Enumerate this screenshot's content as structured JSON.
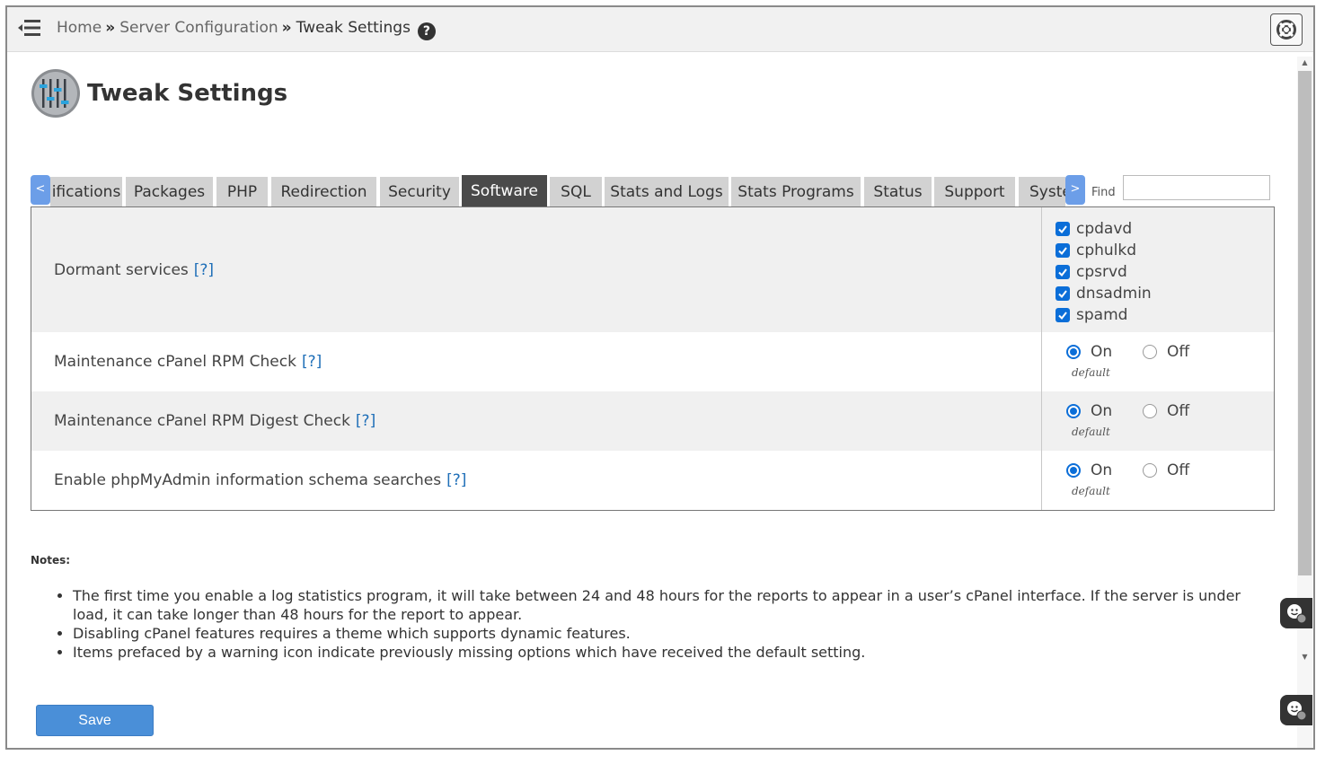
{
  "breadcrumb": {
    "home": "Home",
    "separator": "»",
    "section": "Server Configuration",
    "current": "Tweak Settings",
    "help_glyph": "?"
  },
  "page": {
    "title": "Tweak Settings"
  },
  "tabs": {
    "scroll_left": "<",
    "scroll_right": ">",
    "items": [
      "ifications",
      "Packages",
      "PHP",
      "Redirection",
      "Security",
      "Software",
      "SQL",
      "Stats and Logs",
      "Stats Programs",
      "Status",
      "Support",
      "Syste"
    ],
    "active": "Software"
  },
  "find": {
    "label": "Find",
    "value": ""
  },
  "settings": {
    "dormant": {
      "label": "Dormant services",
      "help": "[?]",
      "options": [
        "cpdavd",
        "cphulkd",
        "cpsrvd",
        "dnsadmin",
        "spamd"
      ],
      "checked": [
        true,
        true,
        true,
        true,
        true
      ]
    },
    "rpm_check": {
      "label": "Maintenance cPanel RPM Check",
      "help": "[?]",
      "on": "On",
      "off": "Off",
      "selected": "On",
      "note": "default"
    },
    "rpm_digest": {
      "label": "Maintenance cPanel RPM Digest Check",
      "help": "[?]",
      "on": "On",
      "off": "Off",
      "selected": "On",
      "note": "default"
    },
    "phpmyadmin": {
      "label": "Enable phpMyAdmin information schema searches",
      "help": "[?]",
      "on": "On",
      "off": "Off",
      "selected": "On",
      "note": "default"
    }
  },
  "notes": {
    "heading": "Notes:",
    "items": [
      "The first time you enable a log statistics program, it will take between 24 and 48 hours for the reports to appear in a user’s cPanel interface. If the server is under load, it can take longer than 48 hours for the report to appear.",
      "Disabling cPanel features requires a theme which supports dynamic features.",
      "Items prefaced by a warning icon indicate previously missing options which have received the default setting."
    ]
  },
  "save_label": "Save",
  "colors": {
    "accent": "#4a8fd8",
    "active_tab": "#4a4a4a",
    "tab": "#d2d2d2",
    "link": "#1f6fb8",
    "checkbox": "#0b6ed8"
  },
  "icons": {
    "menu": "menu-collapse-icon",
    "help": "help-circle-icon",
    "support": "lifebuoy-icon",
    "page": "sliders-icon",
    "chat": "chat-agent-icon"
  }
}
